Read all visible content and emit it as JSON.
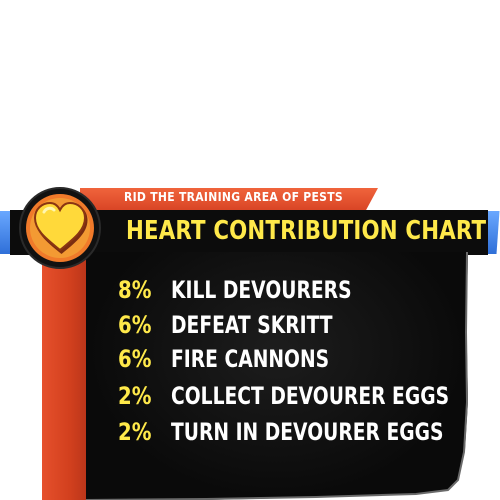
{
  "heart_chart": {
    "subtitle": "RID THE TRAINING AREA OF PESTS",
    "title": "HEART CONTRIBUTION CHART",
    "icon": "heart-icon",
    "colors": {
      "accent_yellow": "#ffe94a",
      "ribbon_orange": "#e6502c",
      "panel_black": "#0c0c0c",
      "cap_blue": "#3f7fe8"
    },
    "items": [
      {
        "percent": "8%",
        "task": "KILL DEVOURERS"
      },
      {
        "percent": "6%",
        "task": "DEFEAT SKRITT"
      },
      {
        "percent": "6%",
        "task": "FIRE CANNONS"
      },
      {
        "percent": "2%",
        "task": "COLLECT DEVOURER EGGS"
      },
      {
        "percent": "2%",
        "task": "TURN IN DEVOURER EGGS"
      }
    ]
  }
}
